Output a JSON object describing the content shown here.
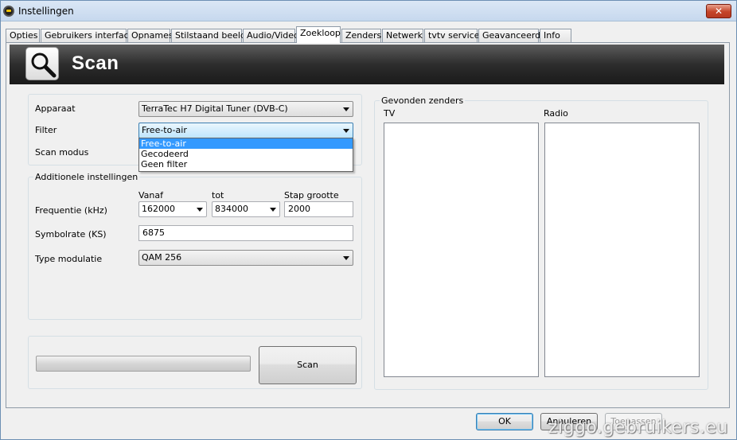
{
  "window": {
    "title": "Instellingen",
    "close_label": "✕"
  },
  "tabs": [
    {
      "label": "Opties"
    },
    {
      "label": "Gebruikers interface"
    },
    {
      "label": "Opnames"
    },
    {
      "label": "Stilstaand beeld"
    },
    {
      "label": "Audio/Video"
    },
    {
      "label": "Zoekloop",
      "active": true
    },
    {
      "label": "Zenders"
    },
    {
      "label": "Netwerk"
    },
    {
      "label": "tvtv service"
    },
    {
      "label": "Geavanceerd"
    },
    {
      "label": "Info"
    }
  ],
  "header": {
    "title": "Scan",
    "icon": "magnifier-icon"
  },
  "scan_settings": {
    "device_label": "Apparaat",
    "device_value": "TerraTec H7 Digital Tuner (DVB-C)",
    "filter_label": "Filter",
    "filter_value": "Free-to-air",
    "filter_options": [
      "Free-to-air",
      "Gecodeerd",
      "Geen filter"
    ],
    "filter_selected_index": 0,
    "scan_mode_label": "Scan modus"
  },
  "additional": {
    "legend": "Additionele instellingen",
    "from_label": "Vanaf",
    "to_label": "tot",
    "step_label": "Stap grootte",
    "frequency_label": "Frequentie (kHz)",
    "frequency_from": "162000",
    "frequency_to": "834000",
    "step_value": "2000",
    "symbolrate_label": "Symbolrate (KS)",
    "symbolrate_value": "6875",
    "modulation_label": "Type modulatie",
    "modulation_value": "QAM 256"
  },
  "scan": {
    "button_label": "Scan",
    "progress": 0
  },
  "found": {
    "legend": "Gevonden zenders",
    "tv_label": "TV",
    "radio_label": "Radio"
  },
  "footer": {
    "ok": "OK",
    "cancel": "Annuleren",
    "apply": "Toepassen"
  },
  "watermark": "ziggo.gebruikers.eu",
  "colors": {
    "selection": "#3399ff",
    "banner": "#2d2d2d",
    "title_bar": "#c6d8ee"
  }
}
